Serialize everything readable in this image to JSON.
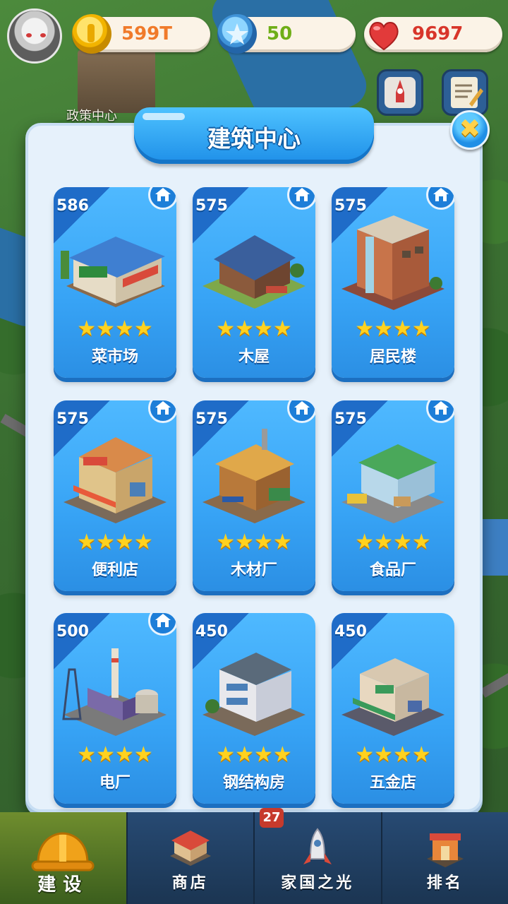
{
  "hud": {
    "coins": "599T",
    "stars": "50",
    "hearts": "9697"
  },
  "background": {
    "policy_center_label": "政策中心"
  },
  "dialog": {
    "title": "建筑中心",
    "close_symbol": "✖"
  },
  "buildings": [
    {
      "name": "菜市场",
      "price": "586",
      "stars": "★★★★",
      "has_home_badge": true
    },
    {
      "name": "木屋",
      "price": "575",
      "stars": "★★★★",
      "has_home_badge": true
    },
    {
      "name": "居民楼",
      "price": "575",
      "stars": "★★★★",
      "has_home_badge": true
    },
    {
      "name": "便利店",
      "price": "575",
      "stars": "★★★★",
      "has_home_badge": true
    },
    {
      "name": "木材厂",
      "price": "575",
      "stars": "★★★★",
      "has_home_badge": true
    },
    {
      "name": "食品厂",
      "price": "575",
      "stars": "★★★★",
      "has_home_badge": true
    },
    {
      "name": "电厂",
      "price": "500",
      "stars": "★★★★",
      "has_home_badge": true
    },
    {
      "name": "钢结构房",
      "price": "450",
      "stars": "★★★★",
      "has_home_badge": false
    },
    {
      "name": "五金店",
      "price": "450",
      "stars": "★★★★",
      "has_home_badge": false
    }
  ],
  "nav": {
    "items": [
      {
        "label": "建设",
        "icon": "hardhat-icon",
        "active": true
      },
      {
        "label": "商店",
        "icon": "shop-icon",
        "active": false
      },
      {
        "label": "家国之光",
        "icon": "rocket-icon",
        "active": false
      },
      {
        "label": "排名",
        "icon": "ranking-icon",
        "active": false
      }
    ],
    "shop_badge": "27"
  },
  "colors": {
    "coin_text": "#f07a2a",
    "star_text": "#6fae17",
    "heart_text": "#d8352a",
    "card_blue": "#37a3f5",
    "star_gold": "#ffd21f"
  }
}
